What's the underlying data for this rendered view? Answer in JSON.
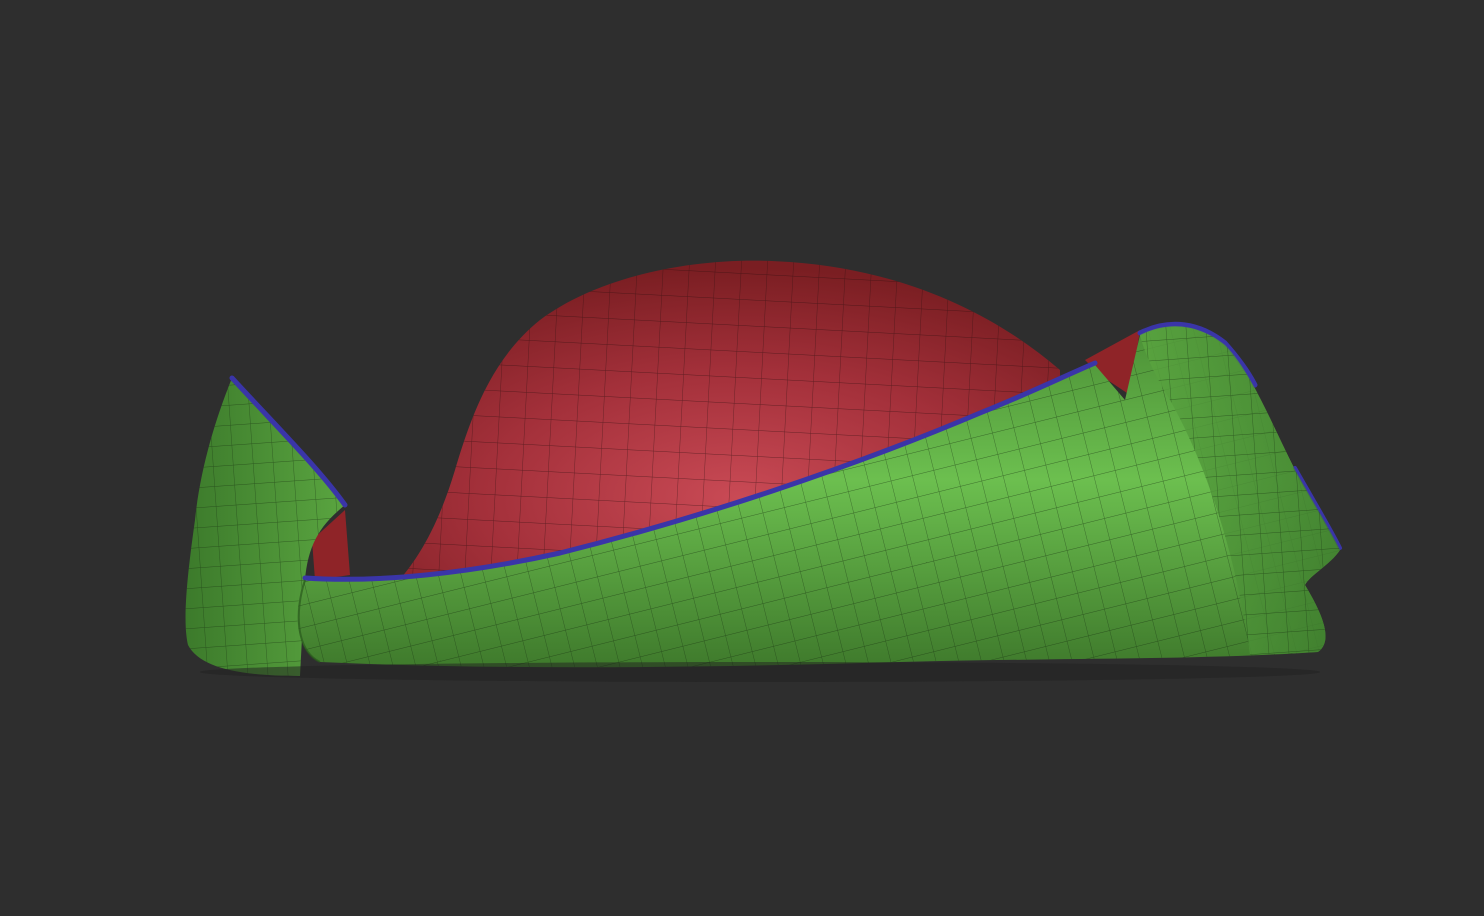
{
  "viewport": {
    "background_color": "#2e2e2e"
  },
  "model": {
    "polygroups": [
      {
        "name": "crown",
        "color": "#9a2a2d",
        "highlight": "#c94a55"
      },
      {
        "name": "brim",
        "color": "#4f9a3a",
        "highlight": "#6cbf4f"
      },
      {
        "name": "brim-edge",
        "color": "#3a35a8"
      }
    ],
    "wireframe_color": "#1a1a1a"
  }
}
